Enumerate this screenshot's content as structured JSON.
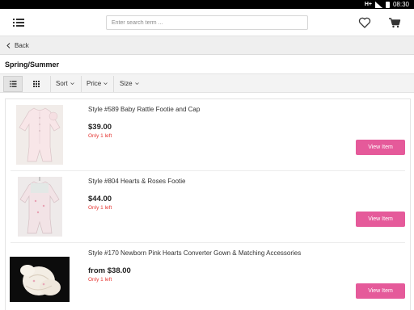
{
  "status_bar": {
    "network": "H+",
    "time": "08:30"
  },
  "header": {
    "search_placeholder": "Enter search term ...",
    "menu_icon": "hamburger-menu-icon",
    "wishlist_icon": "heart-icon",
    "cart_icon": "cart-icon"
  },
  "nav": {
    "back_label": "Back"
  },
  "page": {
    "title": "Spring/Summer"
  },
  "toolbar": {
    "sort_label": "Sort",
    "price_label": "Price",
    "size_label": "Size",
    "list_view_icon": "list-view-icon",
    "grid_view_icon": "grid-view-icon"
  },
  "products": [
    {
      "title": "Style #589 Baby Rattle Footie and Cap",
      "price": "$39.00",
      "stock": "Only 1 left",
      "button": "View Item"
    },
    {
      "title": "Style #804 Hearts & Roses Footie",
      "price": "$44.00",
      "stock": "Only 1 left",
      "button": "View Item"
    },
    {
      "title": "Style #170 Newborn Pink Hearts Converter Gown & Matching Accessories",
      "price": "from $38.00",
      "stock": "Only 1 left",
      "button": "View Item"
    }
  ],
  "colors": {
    "accent": "#e55a9a",
    "stock_warning": "#e53935"
  }
}
